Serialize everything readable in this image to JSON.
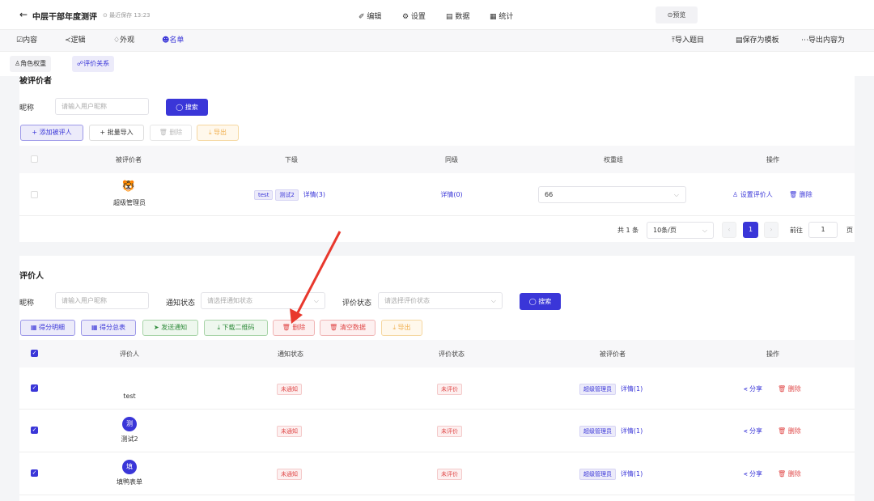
{
  "header": {
    "back": "←",
    "title": "中层干部年度测评",
    "saved": "⊙ 最近保存 13:23",
    "menu": [
      "✐ 编辑",
      "⚙ 设置",
      "▤ 数据",
      "▦ 统计"
    ],
    "preview": "⊙预览"
  },
  "tabs": {
    "items": [
      "☑内容",
      "≺逻辑",
      "♢外观",
      "☻名单"
    ],
    "right": [
      "⤒导入题目",
      "▤保存为模板",
      "⋯导出内容为"
    ]
  },
  "subtabs": [
    "♙角色权重",
    "☍评价关系"
  ],
  "evaluated": {
    "title": "被评价者",
    "nick_label": "昵称",
    "nick_placeholder": "请输入用户昵称",
    "search": "◯ 搜索",
    "buttons": [
      "+ 添加被评人",
      "+ 批量导入",
      "🗑 删除",
      "⤓ 导出"
    ],
    "columns": [
      "被评价者",
      "下级",
      "同级",
      "权重组",
      "操作"
    ],
    "rows": [
      {
        "name": "超级管理员",
        "avatar": "🐯",
        "sub_tags": [
          "test",
          "测试2"
        ],
        "sub_detail": "详情(3)",
        "peer": "详情(0)",
        "weight": "66",
        "op_set": "♙ 设置评价人",
        "op_del": "🗑 删除"
      }
    ],
    "pagination": {
      "total": "共 1 条",
      "size": "10条/页",
      "page": "1",
      "goto": "前往",
      "goto_val": "1",
      "unit": "页"
    }
  },
  "evaluators": {
    "title": "评价人",
    "nick_label": "昵称",
    "nick_placeholder": "请输入用户昵称",
    "notify_label": "通知状态",
    "notify_placeholder": "请选择通知状态",
    "eval_label": "评价状态",
    "eval_placeholder": "请选择评价状态",
    "search": "◯ 搜索",
    "buttons": [
      "▦ 得分明细",
      "▦ 得分总表",
      "➤ 发送通知",
      "⤓ 下载二维码",
      "🗑 删除",
      "🗑 清空数据",
      "⤓ 导出"
    ],
    "columns": [
      "评价人",
      "通知状态",
      "评价状态",
      "被评价者",
      "操作"
    ],
    "rows": [
      {
        "name": "test",
        "avatar": "",
        "notify": "未通知",
        "eval": "未评价",
        "target": "超级管理员",
        "detail": "详情(1)",
        "share": "⪪ 分享",
        "del": "🗑 删除"
      },
      {
        "name": "测试2",
        "avatar": "测",
        "notify": "未通知",
        "eval": "未评价",
        "target": "超级管理员",
        "detail": "详情(1)",
        "share": "⪪ 分享",
        "del": "🗑 删除"
      },
      {
        "name": "填鸭表单",
        "avatar": "填",
        "notify": "未通知",
        "eval": "未评价",
        "target": "超级管理员",
        "detail": "详情(1)",
        "share": "⪪ 分享",
        "del": "🗑 删除"
      }
    ]
  },
  "colors": {
    "accent": "#3a36d8",
    "danger": "#e04848",
    "arrow": "#e8382d"
  }
}
